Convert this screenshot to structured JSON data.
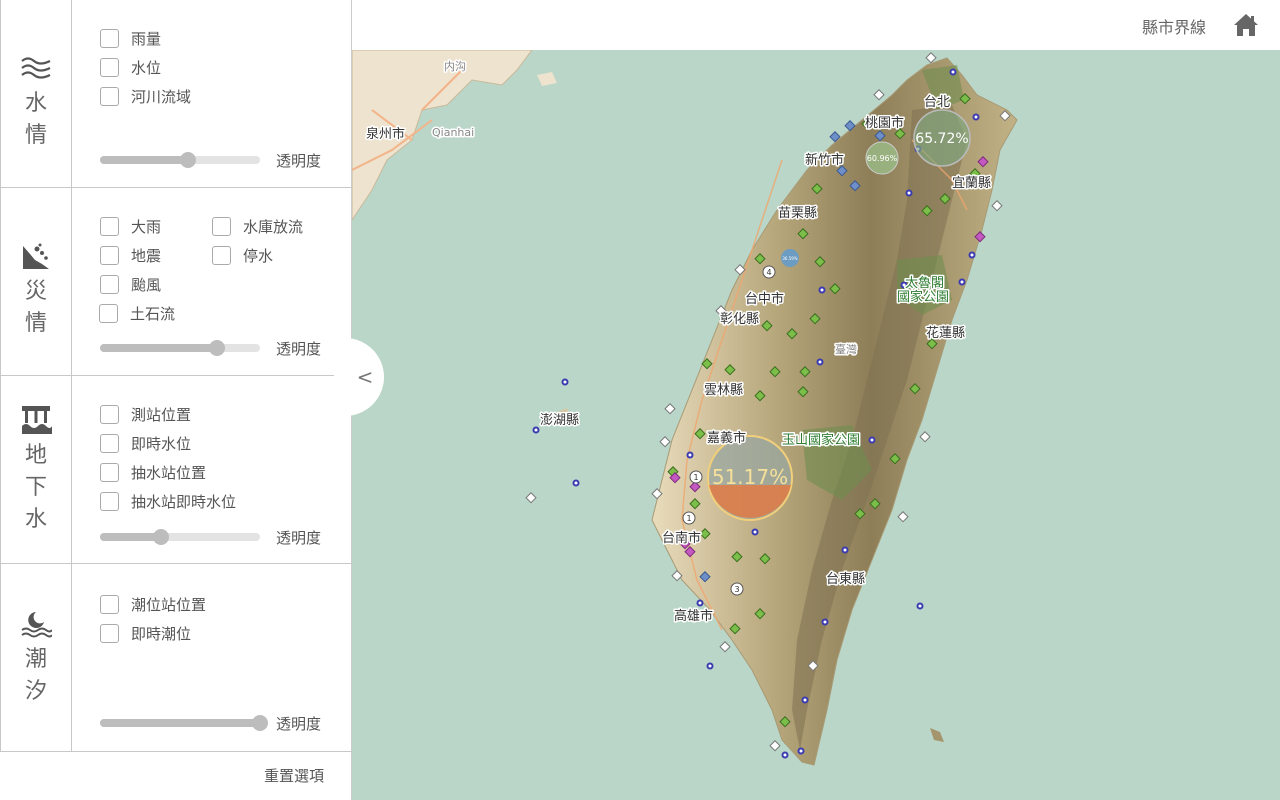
{
  "topbar": {
    "boundary_label": "縣市界線",
    "home_icon": "home-icon"
  },
  "sections": {
    "water": {
      "title": "水情",
      "icon": "water-waves-icon",
      "options": [
        "雨量",
        "水位",
        "河川流域"
      ],
      "opacity_label": "透明度",
      "opacity": 0.55
    },
    "disaster": {
      "title": "災情",
      "icon": "landslide-icon",
      "options": [
        "大雨",
        "水庫放流",
        "地震",
        "停水",
        "颱風",
        "土石流"
      ],
      "opacity_label": "透明度",
      "opacity": 0.73
    },
    "groundwater": {
      "title": "地下水",
      "icon": "groundwater-icon",
      "options": [
        "測站位置",
        "即時水位",
        "抽水站位置",
        "抽水站即時水位"
      ],
      "opacity_label": "透明度",
      "opacity": 0.38
    },
    "tide": {
      "title": "潮汐",
      "icon": "tide-moon-icon",
      "options": [
        "潮位站位置",
        "即時潮位"
      ],
      "opacity_label": "透明度",
      "opacity": 1.0
    }
  },
  "reset_label": "重置選項",
  "collapse_label": "<",
  "map": {
    "labels": {
      "quanzhou": "泉州市",
      "qianhai": "Qianhai",
      "neigou": "内沟",
      "taipei": "台北",
      "taoyuan": "桃園市",
      "hsinchu": "新竹市",
      "yilan": "宜蘭縣",
      "miaoli": "苗栗縣",
      "taichung": "台中市",
      "changhua": "彰化縣",
      "taroko": "太魯閣",
      "taroko2": "國家公園",
      "hualien": "花蓮縣",
      "taiwan": "臺灣",
      "yunlin": "雲林縣",
      "penghu": "澎湖縣",
      "chiayi": "嘉義市",
      "yushan": "玉山國家公園",
      "tainan": "台南市",
      "taitung": "台東縣",
      "kaohsiung": "高雄市"
    },
    "clusters": {
      "north": "65.72%",
      "hsinchu": "60.96%",
      "south": "51.17%",
      "small": "36.59%"
    },
    "colors": {
      "sea": "#b9d6c8",
      "land": "#e8dcc0",
      "mountain": "#8a7d5c",
      "forest": "#7e9a5c"
    }
  }
}
